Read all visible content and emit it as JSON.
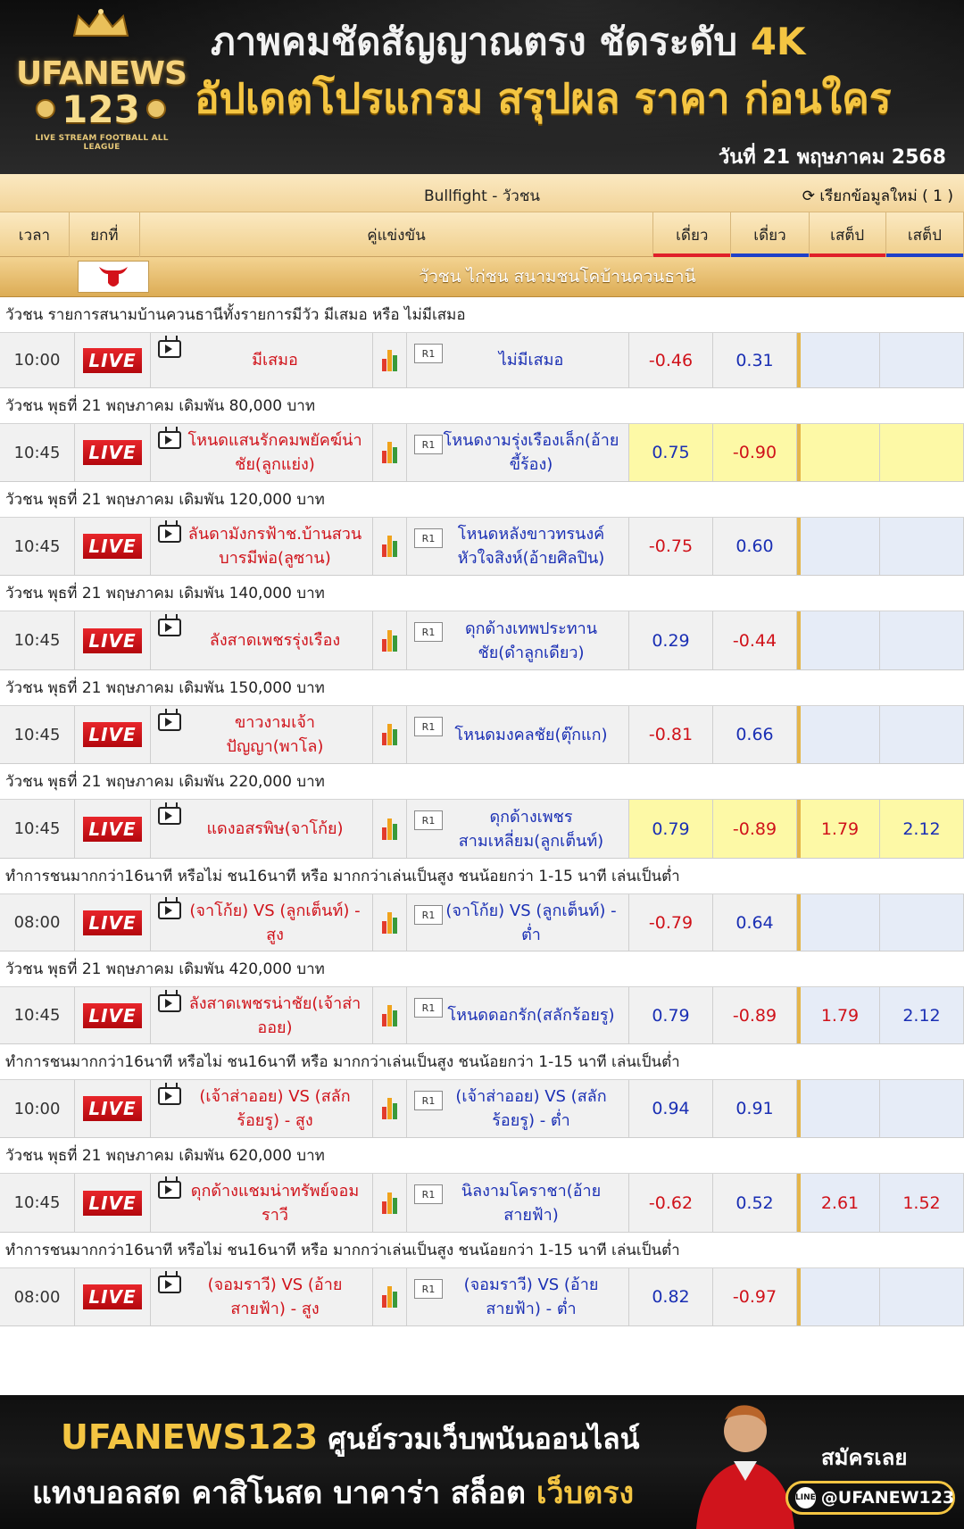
{
  "banner": {
    "logo_brand": "UFANEWS",
    "logo_num": "123",
    "logo_tag": "LIVE STREAM FOOTBALL ALL LEAGUE",
    "headline1_a": "ภาพคมชัดสัญญาณตรง ชัดระดับ ",
    "headline1_b": "4K",
    "headline2": "อัปเดตโปรแกรม สรุปผล ราคา ก่อนใคร",
    "date": "วันที่ 21 พฤษภาคม 2568"
  },
  "board": {
    "title": "Bullfight - วัวชน",
    "refresh": "เรียกข้อมูลใหม่ ( 1 )",
    "headers": {
      "time": "เวลา",
      "live": "ยกที่",
      "match": "คู่แข่งขัน",
      "o1": "เดี่ยว",
      "o2": "เดี่ยว",
      "o3": "เสต็ป",
      "o4": "เสต็ป"
    },
    "league": "วัวชน ไก่ชน สนามชนโคบ้านควนธานี",
    "live_label": "LIVE",
    "r1_label": "R1"
  },
  "rows": [
    {
      "section": "วัวชน รายการสนามบ้านควนธานีทั้งรายการมีวัว มีเสมอ หรือ ไม่มีเสมอ",
      "time": "10:00",
      "home": "มีเสมอ",
      "away": "ไม่มีเสมอ",
      "o1": "-0.46",
      "o2": "0.31",
      "o3": "",
      "o4": "",
      "hl": false
    },
    {
      "section": "วัวชน พุธที่ 21 พฤษภาคม เดิมพัน 80,000 บาท",
      "time": "10:45",
      "home": "โหนดแสนรักคมพยัคฆ์น่าชัย(ลูกแย่ง)",
      "away": "โหนดงามรุ่งเรืองเล็ก(อ้ายขี้ร้อง)",
      "o1": "0.75",
      "o2": "-0.90",
      "o3": "",
      "o4": "",
      "hl": true
    },
    {
      "section": "วัวชน พุธที่ 21 พฤษภาคม เดิมพัน 120,000 บาท",
      "time": "10:45",
      "home": "ลันดามังกรฟ้าช.บ้านสวนบารมีพ่อ(ลูซาน)",
      "away": "โหนดหลังขาวทรนงค์หัวใจสิงห์(อ้ายศิลปิน)",
      "o1": "-0.75",
      "o2": "0.60",
      "o3": "",
      "o4": "",
      "hl": false
    },
    {
      "section": "วัวชน พุธที่ 21 พฤษภาคม เดิมพัน 140,000 บาท",
      "time": "10:45",
      "home": "ลังสาดเพชรรุ่งเรือง",
      "away": "ดุกด้างเทพประทานชัย(ดำลูกเดียว)",
      "o1": "0.29",
      "o2": "-0.44",
      "o3": "",
      "o4": "",
      "hl": false
    },
    {
      "section": "วัวชน พุธที่ 21 พฤษภาคม เดิมพัน 150,000 บาท",
      "time": "10:45",
      "home": "ขาวงามเจ้าปัญญา(พาโล)",
      "away": "โหนดมงคลชัย(ตุ๊กแก)",
      "o1": "-0.81",
      "o2": "0.66",
      "o3": "",
      "o4": "",
      "hl": false
    },
    {
      "section": "วัวชน พุธที่ 21 พฤษภาคม เดิมพัน 220,000 บาท",
      "time": "10:45",
      "home": "แดงอสรพิษ(จาโก้ย)",
      "away": "ดุกด้างเพชรสามเหลี่ยม(ลูกเต็นท์)",
      "o1": "0.79",
      "o2": "-0.89",
      "o3": "1.79",
      "o4": "2.12",
      "hl": true
    },
    {
      "section": "ทำการชนมากกว่า16นาที หรือไม่ ชน16นาที หรือ มากกว่าเล่นเป็นสูง ชนน้อยกว่า 1-15 นาที เล่นเป็นต่ำ",
      "time": "08:00",
      "home": "(จาโก้ย) VS (ลูกเต็นท์) - สูง",
      "away": "(จาโก้ย) VS (ลูกเต็นท์) - ต่ำ",
      "o1": "-0.79",
      "o2": "0.64",
      "o3": "",
      "o4": "",
      "hl": false
    },
    {
      "section": "วัวชน พุธที่ 21 พฤษภาคม เดิมพัน 420,000 บาท",
      "time": "10:45",
      "home": "ลังสาดเพชรน่าชัย(เจ้าส่าออย)",
      "away": "โหนดดอกรัก(สลักร้อยรู)",
      "o1": "0.79",
      "o2": "-0.89",
      "o3": "1.79",
      "o4": "2.12",
      "hl": false
    },
    {
      "section": "ทำการชนมากกว่า16นาที หรือไม่ ชน16นาที หรือ มากกว่าเล่นเป็นสูง ชนน้อยกว่า 1-15 นาที เล่นเป็นต่ำ",
      "time": "10:00",
      "home": "(เจ้าส่าออย) VS (สลักร้อยรู) - สูง",
      "away": "(เจ้าส่าออย) VS (สลักร้อยรู) - ต่ำ",
      "o1": "0.94",
      "o2": "0.91",
      "o3": "",
      "o4": "",
      "hl": false
    },
    {
      "section": "วัวชน พุธที่ 21 พฤษภาคม เดิมพัน 620,000 บาท",
      "time": "10:45",
      "home": "ดุกด้างแชมน่าทรัพย์จอมราวี",
      "away": "นิลงามโคราชา(อ้ายสายฟ้า)",
      "o1": "-0.62",
      "o2": "0.52",
      "o3": "2.61",
      "o4": "1.52",
      "hl": false
    },
    {
      "section": "ทำการชนมากกว่า16นาที หรือไม่ ชน16นาที หรือ มากกว่าเล่นเป็นสูง ชนน้อยกว่า 1-15 นาที เล่นเป็นต่ำ",
      "time": "08:00",
      "home": "(จอมราวี) VS (อ้ายสายฟ้า) - สูง",
      "away": "(จอมราวี) VS (อ้ายสายฟ้า) - ต่ำ",
      "o1": "0.82",
      "o2": "-0.97",
      "o3": "",
      "o4": "",
      "hl": false
    }
  ],
  "footer": {
    "brand": "UFANEWS123",
    "tagline1": " ศูนย์รวมเว็บพนันออนไลน์",
    "tagline2_a": "แทงบอลสด คาสิโนสด บาคาร่า สล็อต ",
    "tagline2_b": "เว็บตรง",
    "signup": "สมัครเลย",
    "line_id": "@UFANEW123",
    "line_icon": "LINE"
  }
}
